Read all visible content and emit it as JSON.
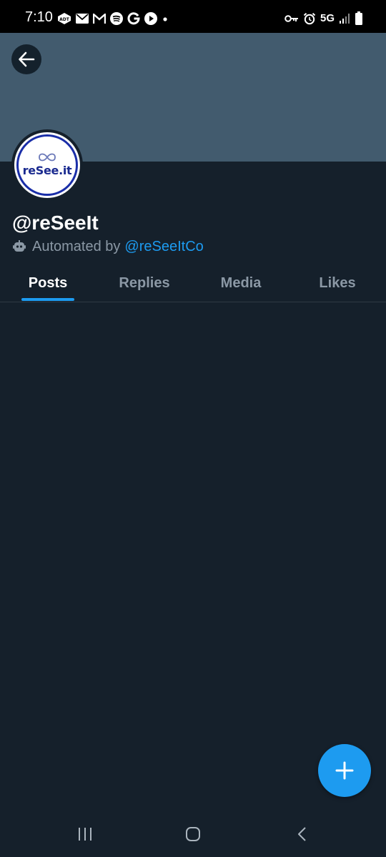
{
  "status_bar": {
    "time": "7:10",
    "network": "5G",
    "notification_icons": [
      "adt-icon",
      "mail-icon",
      "gmail-icon",
      "spotify-icon",
      "google-icon",
      "play-icon",
      "dot-icon"
    ],
    "right_icons": [
      "vpn-key-icon",
      "alarm-icon",
      "signal-icon",
      "battery-icon"
    ]
  },
  "colors": {
    "background": "#15202b",
    "banner": "#425b6e",
    "accent": "#1d9bf0",
    "muted_text": "#8b98a5"
  },
  "profile": {
    "avatar_text": "reSee.it",
    "handle": "@reSeeIt",
    "automated_prefix": "Automated by",
    "automated_link": "@reSeeItCo"
  },
  "tabs": [
    {
      "label": "Posts",
      "active": true
    },
    {
      "label": "Replies",
      "active": false
    },
    {
      "label": "Media",
      "active": false
    },
    {
      "label": "Likes",
      "active": false
    }
  ],
  "fab_icon": "plus-icon",
  "nav_bar": [
    "recent-apps-icon",
    "home-icon",
    "back-icon"
  ]
}
